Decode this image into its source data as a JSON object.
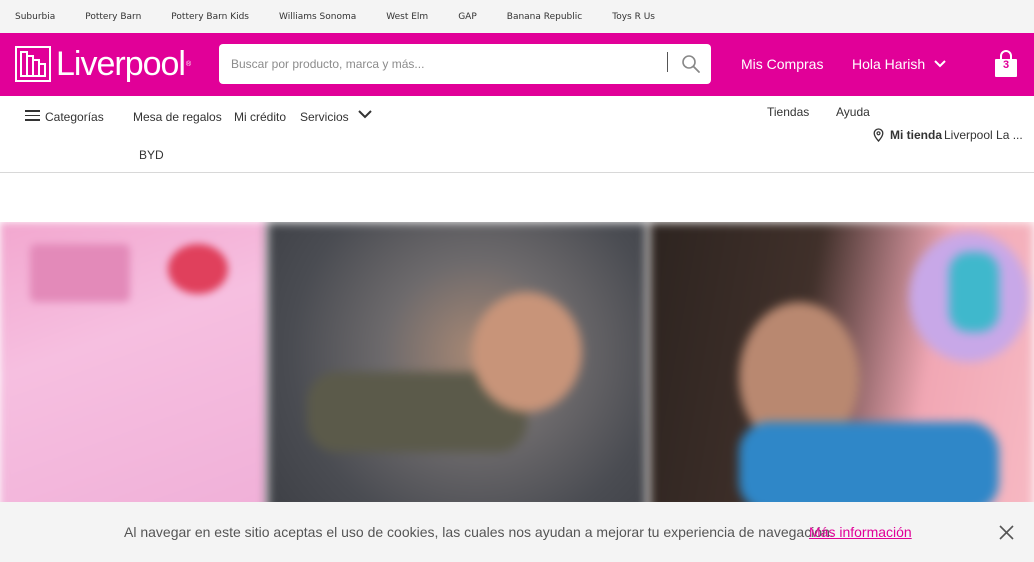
{
  "brand_links": [
    "Suburbia",
    "Pottery Barn",
    "Pottery Barn Kids",
    "Williams Sonoma",
    "West Elm",
    "GAP",
    "Banana Republic",
    "Toys R Us"
  ],
  "header": {
    "logo_text": "Liverpool",
    "logo_reg": "®",
    "search_placeholder": "Buscar por producto, marca y más...",
    "mis_compras": "Mis Compras",
    "greeting": "Hola Harish",
    "cart_count": "3"
  },
  "nav": {
    "categorias": "Categorías",
    "mesa": "Mesa de regalos",
    "credito": "Mi crédito",
    "servicios": "Servicios",
    "byd": "BYD",
    "tiendas": "Tiendas",
    "ayuda": "Ayuda",
    "mi_tienda_label": "Mi tienda",
    "mi_tienda_value": "Liverpool La ..."
  },
  "cookie": {
    "text": "Al navegar en este sitio aceptas el uso de cookies, las cuales nos ayudan a mejorar tu experiencia de navegación.",
    "link": "Más información"
  },
  "colors": {
    "brand": "#e10098",
    "brandbar_bg": "#f4f4f4"
  }
}
